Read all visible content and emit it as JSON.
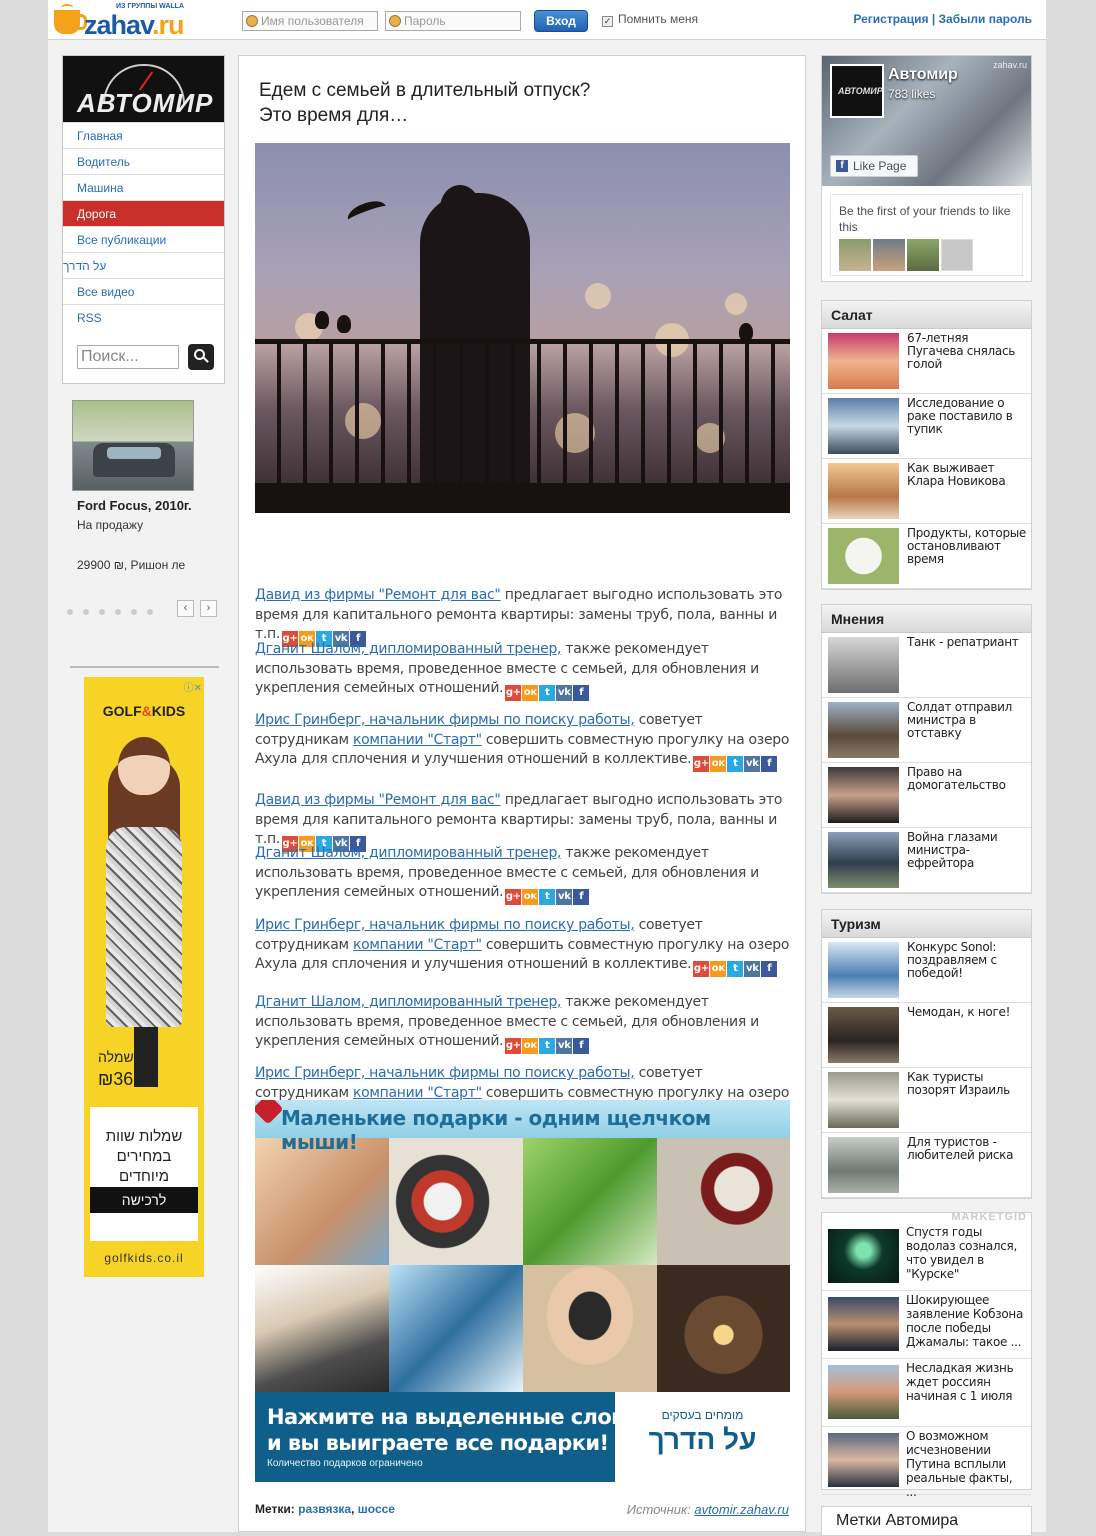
{
  "topbar": {
    "logo_word": "zahav",
    "logo_tld": ".ru",
    "logo_tagline": "ИЗ ГРУППЫ WALLA",
    "username_placeholder": "Имя пользователя",
    "password_placeholder": "Пароль",
    "login_label": "Вход",
    "remember_label": "Помнить меня",
    "register_label": "Регистрация",
    "separator": " | ",
    "forgot_label": "Забыли пароль"
  },
  "leftnav": {
    "brand": "АВТОМИР",
    "items": [
      {
        "label": "Главная",
        "active": false
      },
      {
        "label": "Водитель",
        "active": false
      },
      {
        "label": "Машина",
        "active": false
      },
      {
        "label": "Дорога",
        "active": true
      },
      {
        "label": "Все публикации",
        "active": false
      },
      {
        "label": "על הדרך",
        "active": false
      },
      {
        "label": "Все видео",
        "active": false
      },
      {
        "label": "RSS",
        "active": false
      }
    ],
    "search_placeholder": "Поиск..."
  },
  "car_listing": {
    "title": "Ford Focus, 2010г.",
    "subtitle": "На продажу",
    "price": "29900 ₪, Ришон ле",
    "prev": "‹",
    "next": "›"
  },
  "left_ad": {
    "brand_a": "GOLF",
    "brand_amp": "&",
    "brand_b": "KIDS",
    "close": "ⓘ✕",
    "price_label": "שמלה",
    "price_value": "₪36",
    "offer_line1": "שמלות שוות",
    "offer_line2": "במחירים מיוחדים",
    "buy_label": "לרכישה",
    "url": "golfkids.co.il"
  },
  "article": {
    "headline_line1": "Едем с семьей в длительный отпуск?",
    "headline_line2": "Это время для…",
    "paragraphs": [
      {
        "link": "Давид из фирмы \"Ремонт для вас\"",
        "text": " предлагает выгодно использовать это время для капитального ремонта квартиры: замены труб, пола, ванны и т.п."
      },
      {
        "link": "Дганит Шалом, дипломированный тренер,",
        "text": " также рекомендует использовать время, проведенное вместе с семьей, для обновления и укрепления семейных отношений."
      },
      {
        "link": "Ирис Гринберг, начальник фирмы по поиску работы,",
        "text": " советует сотрудникам ",
        "link2": "компании \"Старт\"",
        "text2": " совершить совместную прогулку на озеро Ахула для сплочения и улучшения отношений в коллективе."
      },
      {
        "link": "Давид из фирмы \"Ремонт для вас\"",
        "text": " предлагает выгодно использовать это время для капитального ремонта квартиры: замены труб, пола, ванны и т.п."
      },
      {
        "link": "Дганит Шалом, дипломированный тренер,",
        "text": " также рекомендует использовать время, проведенное вместе с семьей, для обновления и укрепления семейных отношений."
      },
      {
        "link": "Ирис Гринберг, начальник фирмы по поиску работы,",
        "text": " советует сотрудникам ",
        "link2": "компании \"Старт\"",
        "text2": " совершить совместную прогулку на озеро Ахула для сплочения и улучшения отношений в коллективе."
      },
      {
        "link": "Дганит Шалом, дипломированный тренер,",
        "text": " также рекомендует использовать время, проведенное вместе с семьей, для обновления и укрепления семейных отношений."
      },
      {
        "link": "Ирис Гринберг, начальник фирмы по поиску работы,",
        "text": " советует сотрудникам ",
        "link2": "компании \"Старт\"",
        "text2": " совершить совместную прогулку на озеро Ахула для сплочения и улучшения отношений в коллективе."
      }
    ],
    "share_icons": [
      {
        "name": "google-plus-icon",
        "glyph": "g+",
        "color": "#dd4b39"
      },
      {
        "name": "odnoklassniki-icon",
        "glyph": "ок",
        "color": "#f59a1b"
      },
      {
        "name": "twitter-icon",
        "glyph": "t",
        "color": "#2aa9e0"
      },
      {
        "name": "vk-icon",
        "glyph": "vk",
        "color": "#4d76a1"
      },
      {
        "name": "facebook-icon",
        "glyph": "f",
        "color": "#3b5998"
      }
    ],
    "promo": {
      "title": "Маленькие подарки - одним щелчком мыши!",
      "cta_line1": "Нажмите на выделенные слова",
      "cta_line2": "и вы выиграете все подарки!",
      "note": "Количество подарков ограничено",
      "partner_line1": "מומחים בעסקים",
      "partner_line2": "על הדרך"
    },
    "tags_label": "Метки:",
    "tag1": "развязка",
    "tag_sep": ", ",
    "tag2": "шоссе",
    "source_label": "Источник:",
    "source_link": "avtomir.zahav.ru"
  },
  "facebook": {
    "page_name": "Автомир",
    "likes": "783 likes",
    "like_button": "Like Page",
    "watermark": "zahav.ru",
    "friends_text": "Be the first of your friends to like this",
    "cover_pic_text": "АВТОМИР"
  },
  "salat": {
    "title": "Салат",
    "items": [
      {
        "text": "67-летняя Пугачева снялась голой"
      },
      {
        "text": "Исследование о раке поставило в тупик"
      },
      {
        "text": "Как выживает Клара Новикова"
      },
      {
        "text": "Продукты, которые остановливают время"
      }
    ]
  },
  "mneniya": {
    "title": "Мнения",
    "items": [
      {
        "text": "Танк - репатриант"
      },
      {
        "text": "Солдат отправил министра в отставку"
      },
      {
        "text": "Право на домогательство"
      },
      {
        "text": "Война глазами министра-ефрейтора"
      }
    ]
  },
  "turizm": {
    "title": "Туризм",
    "items": [
      {
        "text": "Конкурс Sonol: поздравляем с победой!"
      },
      {
        "text": "Чемодан, к ноге!"
      },
      {
        "text": "Как туристы позорят Израиль"
      },
      {
        "text": "Для туристов - любителей риска"
      }
    ]
  },
  "marketgid": {
    "label": "MARKETGID",
    "items": [
      {
        "text": "Спустя годы водолаз сознался, что увидел в \"Курске\""
      },
      {
        "text": "Шокирующее заявление Кобзона после победы Джамалы: такое ..."
      },
      {
        "text": "Несладкая жизнь ждет россиян начиная с 1 июля"
      },
      {
        "text": "О возможном исчезновении Путина всплыли реальные факты, ..."
      }
    ]
  },
  "metki_box": {
    "title": "Метки Автомира"
  }
}
